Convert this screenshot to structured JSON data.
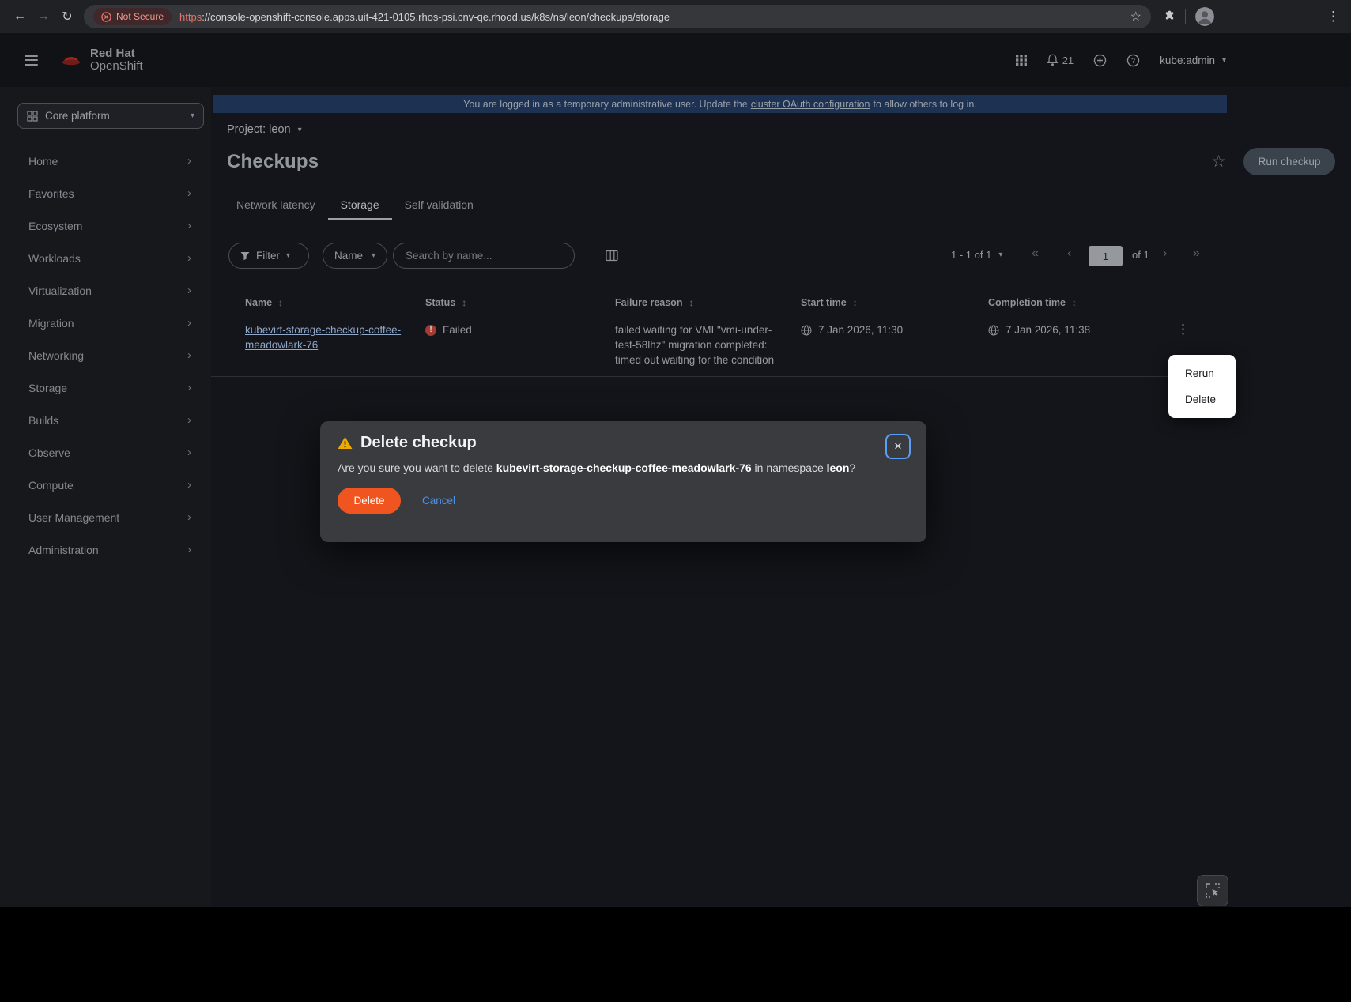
{
  "browser": {
    "security_label": "Not Secure",
    "url_scheme": "https",
    "url_rest": "://console-openshift-console.apps.uit-421-0105.rhos-psi.cnv-qe.rhood.us/k8s/ns/leon/checkups/storage"
  },
  "masthead": {
    "brand_line1": "Red Hat",
    "brand_line2": "OpenShift",
    "notification_count": "21",
    "user_menu_label": "kube:admin"
  },
  "sidebar": {
    "perspective_label": "Core platform",
    "items": [
      "Home",
      "Favorites",
      "Ecosystem",
      "Workloads",
      "Virtualization",
      "Migration",
      "Networking",
      "Storage",
      "Builds",
      "Observe",
      "Compute",
      "User Management",
      "Administration"
    ]
  },
  "banner": {
    "text_before": "You are logged in as a temporary administrative user. Update the",
    "link_text": "cluster OAuth configuration",
    "text_after": "to allow others to log in."
  },
  "project_bar": {
    "label": "Project: leon"
  },
  "page_header": {
    "title": "Checkups",
    "run_button_label": "Run checkup"
  },
  "tabs": [
    {
      "label": "Network latency"
    },
    {
      "label": "Storage"
    },
    {
      "label": "Self validation"
    }
  ],
  "toolbar": {
    "filter_label": "Filter",
    "name_filter_label": "Name",
    "search_placeholder": "Search by name...",
    "pagination_summary": "1 - 1 of 1",
    "page_value": "1",
    "page_of_label": "of 1"
  },
  "table": {
    "columns": [
      "Name",
      "Status",
      "Failure reason",
      "Start time",
      "Completion time"
    ],
    "rows": [
      {
        "name": "kubevirt-storage-checkup-coffee-meadowlark-76",
        "status": "Failed",
        "failure_reason": "failed waiting for VMI \"vmi-under-test-58lhz\" migration completed: timed out waiting for the condition",
        "start_time": "7 Jan 2026, 11:30",
        "completion_time": "7 Jan 2026, 11:38"
      }
    ]
  },
  "kebab_menu": {
    "items": [
      "Rerun",
      "Delete"
    ]
  },
  "modal": {
    "title": "Delete checkup",
    "body_before": "Are you sure you want to delete ",
    "resource_name": "kubevirt-storage-checkup-coffee-meadowlark-76",
    "body_middle": " in namespace ",
    "namespace": "leon",
    "body_after": "?",
    "delete_label": "Delete",
    "cancel_label": "Cancel"
  },
  "colors": {
    "danger": "#f0551f",
    "warning": "#f0ab00",
    "link": "#4f91e8",
    "banner_bg": "#1d3253"
  }
}
